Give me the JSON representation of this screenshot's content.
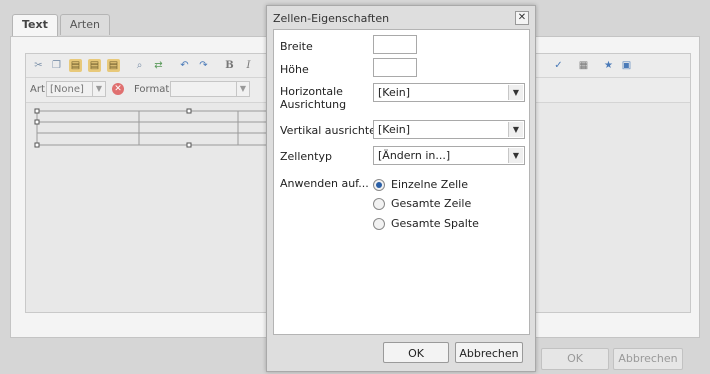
{
  "background": {
    "tabs": [
      {
        "label": "Text",
        "active": true
      },
      {
        "label": "Arten",
        "active": false
      }
    ],
    "toolbar2": {
      "style_label": "Art",
      "style_value": "[None]",
      "format_label": "Format",
      "format_value": ""
    },
    "buttons": {
      "ok": "OK",
      "cancel": "Abbrechen"
    }
  },
  "dialog": {
    "title": "Zellen-Eigenschaften",
    "fields": {
      "width_label": "Breite",
      "width_value": "",
      "height_label": "Höhe",
      "height_value": "",
      "h_align_label": "Horizontale Ausrichtung",
      "h_align_value": "[Kein]",
      "v_align_label": "Vertikal ausrichten",
      "v_align_value": "[Kein]",
      "cell_type_label": "Zellentyp",
      "cell_type_value": "[Ändern in...]",
      "apply_label": "Anwenden auf..."
    },
    "apply_options": [
      {
        "label": "Einzelne Zelle",
        "checked": true
      },
      {
        "label": "Gesamte Zeile",
        "checked": false
      },
      {
        "label": "Gesamte Spalte",
        "checked": false
      }
    ],
    "buttons": {
      "ok": "OK",
      "cancel": "Abbrechen"
    }
  },
  "colors": {
    "radio_selected": "#2a5fa6",
    "clear_button": "#e07070"
  },
  "icons": [
    "cut-icon",
    "copy-icon",
    "paste-icon",
    "paste-text-icon",
    "paste-word-icon",
    "find-icon",
    "replace-icon",
    "undo-icon",
    "redo-icon",
    "bold-icon",
    "italic-icon",
    "spellcheck-icon",
    "table-icon",
    "special-char-icon",
    "image-icon",
    "close-icon",
    "clear-style-icon",
    "chevron-down-icon"
  ]
}
